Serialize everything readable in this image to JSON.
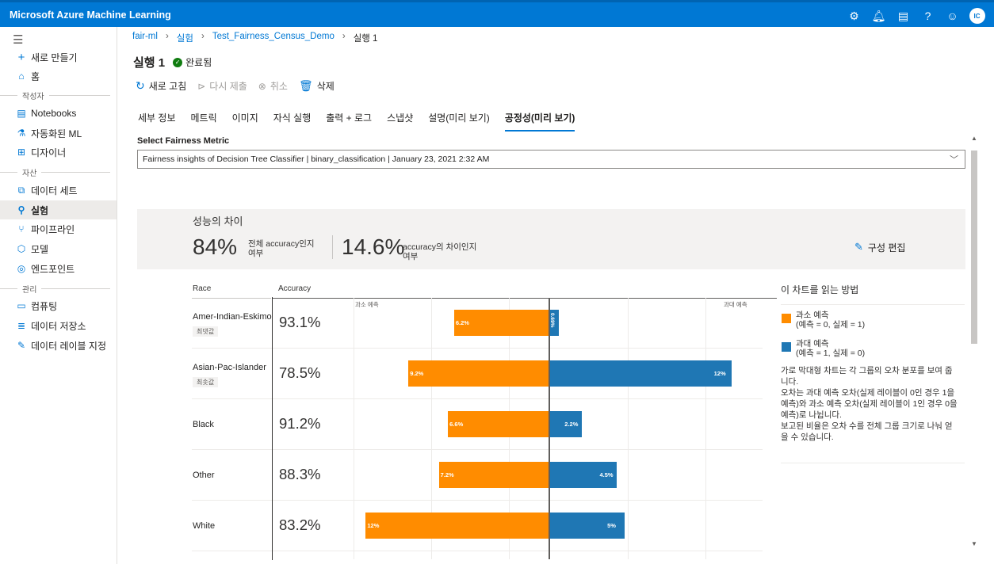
{
  "app": {
    "title": "Microsoft Azure Machine Learning",
    "avatar_initials": "IC",
    "top_icons": [
      "gear-icon",
      "bell-icon",
      "feedback-icon",
      "help-icon",
      "smiley-icon"
    ]
  },
  "sidebar": {
    "items": [
      {
        "label": "새로 만들기",
        "icon": "plus-icon"
      },
      {
        "label": "홈",
        "icon": "home-icon"
      },
      {
        "label": "Notebooks",
        "icon": "notebook-icon"
      },
      {
        "label": "자동화된 ML",
        "icon": "automl-icon"
      },
      {
        "label": "디자이너",
        "icon": "designer-icon"
      },
      {
        "label": "데이터 세트",
        "icon": "dataset-icon"
      },
      {
        "label": "실험",
        "icon": "flask-icon",
        "active": true
      },
      {
        "label": "파이프라인",
        "icon": "pipeline-icon"
      },
      {
        "label": "모델",
        "icon": "model-icon"
      },
      {
        "label": "엔드포인트",
        "icon": "endpoint-icon"
      },
      {
        "label": "컴퓨팅",
        "icon": "compute-icon"
      },
      {
        "label": "데이터 저장소",
        "icon": "datastore-icon"
      },
      {
        "label": "데이터 레이블 지정",
        "icon": "label-icon"
      }
    ],
    "sections": [
      "작성자",
      "자산",
      "관리"
    ]
  },
  "breadcrumb": [
    "fair-ml",
    "실험",
    "Test_Fairness_Census_Demo",
    "실행 1"
  ],
  "run": {
    "title": "실행 1",
    "status": "완료됨"
  },
  "commands": [
    {
      "label": "새로 고침",
      "enabled": true
    },
    {
      "label": "다시 제출",
      "enabled": false
    },
    {
      "label": "취소",
      "enabled": false
    },
    {
      "label": "삭제",
      "enabled": true
    }
  ],
  "tabs": [
    "세부 정보",
    "메트릭",
    "이미지",
    "자식 실행",
    "출력 + 로그",
    "스냅샷",
    "설명(미리 보기)",
    "공정성(미리 보기)"
  ],
  "active_tab": "공정성(미리 보기)",
  "fairness": {
    "select_label": "Select Fairness Metric",
    "selected_value": "Fairness insights of Decision Tree Classifier | binary_classification | January 23, 2021 2:32 AM",
    "summary_title": "성능의 차이",
    "overall_value": "84%",
    "overall_desc": "전체 accuracy인지 여부",
    "disparity_value": "14.6%",
    "disparity_desc": "accuracy의 차이인지 여부",
    "edit_label": "구성 편집"
  },
  "chart_data": {
    "type": "bar",
    "columns": {
      "group": "Race",
      "metric": "Accuracy"
    },
    "axis_labels": {
      "left": "과소 예측",
      "right": "과대 예측"
    },
    "groups": [
      {
        "name": "Amer-Indian-Eskimo",
        "tag": "최댓값",
        "accuracy": "93.1%",
        "under": 6.2,
        "over": 0.69,
        "under_label": "6.2%",
        "over_label": "0.69%"
      },
      {
        "name": "Asian-Pac-Islander",
        "tag": "최솟값",
        "accuracy": "78.5%",
        "under": 9.2,
        "over": 12,
        "under_label": "9.2%",
        "over_label": "12%"
      },
      {
        "name": "Black",
        "tag": "",
        "accuracy": "91.2%",
        "under": 6.6,
        "over": 2.2,
        "under_label": "6.6%",
        "over_label": "2.2%"
      },
      {
        "name": "Other",
        "tag": "",
        "accuracy": "88.3%",
        "under": 7.2,
        "over": 4.5,
        "under_label": "7.2%",
        "over_label": "4.5%"
      },
      {
        "name": "White",
        "tag": "",
        "accuracy": "83.2%",
        "under": 12,
        "over": 5,
        "under_label": "12%",
        "over_label": "5%"
      }
    ],
    "series": [
      {
        "name": "과소 예측",
        "color": "#ff8c00"
      },
      {
        "name": "과대 예측",
        "color": "#1f77b4"
      }
    ],
    "xlim": [
      -12.8,
      13.8
    ]
  },
  "legend": {
    "title": "이 차트를 읽는 방법",
    "under_name": "과소 예측",
    "under_def": "(예측 = 0, 실제 = 1)",
    "over_name": "과대 예측",
    "over_def": "(예측 = 1, 실제 = 0)",
    "explanation": "가로 막대형 차트는 각 그룹의 오차 분포를 보여 줍니다.\n오차는 과대 예측 오차(실제 레이블이 0인 경우 1을 예측)와 과소 예측 오차(실제 레이블이 1인 경우 0을 예측)로 나뉩니다.\n보고된 비율은 오차 수를 전체 그룹 크기로 나눠 얻을 수 있습니다."
  }
}
